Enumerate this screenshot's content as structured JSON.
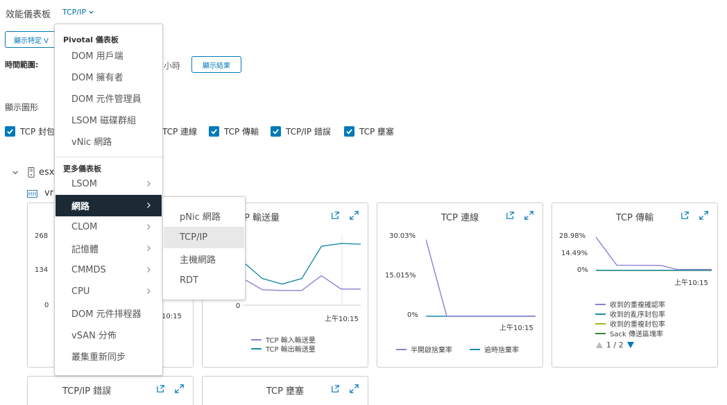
{
  "header": {
    "title": "效能儀表板",
    "dashboard_dropdown": "TCP/IP"
  },
  "filters": {
    "show_specific_label": "顯示特定 V",
    "time_range_label": "時間範圍:",
    "time_range_value": "小時",
    "show_results_label": "顯示結果",
    "show_graph_label": "顯示圖形",
    "graphs": [
      {
        "label": "TCP 封包",
        "checked": true
      },
      {
        "label": "TCP 連線",
        "checked": true
      },
      {
        "label": "TCP 傳輸",
        "checked": true
      },
      {
        "label": "TCP/IP 錯誤",
        "checked": true
      },
      {
        "label": "TCP 壅塞",
        "checked": true
      }
    ]
  },
  "tree": {
    "host_label": "esx",
    "vm_label": "vr"
  },
  "menu": {
    "pivotal_header": "Pivotal 儀表板",
    "pivotal_items": [
      "DOM 用戶端",
      "DOM 擁有者",
      "DOM 元件管理員",
      "LSOM 磁碟群組",
      "vNic 網路"
    ],
    "more_header": "更多儀表板",
    "more_items": [
      {
        "label": "LSOM",
        "submenu": true
      },
      {
        "label": "網路",
        "submenu": true,
        "active": true
      },
      {
        "label": "CLOM",
        "submenu": true
      },
      {
        "label": "記憶體",
        "submenu": true
      },
      {
        "label": "CMMDS",
        "submenu": true
      },
      {
        "label": "CPU",
        "submenu": true
      },
      {
        "label": "DOM 元件排程器",
        "submenu": false
      },
      {
        "label": "vSAN 分佈",
        "submenu": false
      },
      {
        "label": "叢集重新同步",
        "submenu": false
      }
    ]
  },
  "submenu": {
    "items": [
      {
        "label": "pNic 網路"
      },
      {
        "label": "TCP/IP",
        "hover": true
      },
      {
        "label": "主機網路"
      },
      {
        "label": "RDT"
      }
    ]
  },
  "colors": {
    "accent": "#0079b8",
    "menu_active_bg": "#1c2a36",
    "purple": "#8c7fd0",
    "teal": "#1a8ba8",
    "olive": "#a0b81e",
    "green": "#3f7f3f"
  },
  "cards": {
    "packets": {
      "yticks": [
        "268",
        "134",
        "0"
      ],
      "xtick": "10:15"
    },
    "throughput": {
      "title": "TCP 輸送量",
      "title_visible": "P 輸送量",
      "yticks": [
        "0"
      ],
      "xtick": "上午10:15",
      "legend": [
        "TCP 輸入輸送量",
        "TCP 輸出輸送量"
      ]
    },
    "connections": {
      "title": "TCP 連線",
      "yticks": [
        "30.03%",
        "15.015%",
        "0%"
      ],
      "xtick": "上午10:15",
      "legend": [
        "半開啟捨棄率",
        "逾時捨棄率"
      ]
    },
    "transmission": {
      "title": "TCP 傳輸",
      "yticks": [
        "28.98%",
        "14.49%",
        "0%"
      ],
      "xtick": "上午10:15",
      "legend": [
        "收到的重複確認率",
        "收到的亂序封包率",
        "收到的重複封包率",
        "Sack 傳送區塊率"
      ],
      "pager": "1 / 2"
    },
    "errors": {
      "title": "TCP/IP 錯誤"
    },
    "congestion": {
      "title": "TCP 壅塞"
    }
  },
  "chart_data": [
    {
      "type": "line",
      "title": "TCP 輸送量",
      "series": [
        {
          "name": "TCP 輸入輸送量",
          "values": [
            0.38,
            0.22,
            0.21,
            0.21,
            0.42,
            0.23,
            0.23
          ]
        },
        {
          "name": "TCP 輸出輸送量",
          "values": [
            0.62,
            0.38,
            0.3,
            0.38,
            0.84,
            0.88,
            0.87
          ]
        }
      ],
      "ylim": [
        0,
        1
      ]
    },
    {
      "type": "line",
      "title": "TCP 連線",
      "series": [
        {
          "name": "半開啟捨棄率",
          "x": [
            0,
            0.19,
            1
          ],
          "values": [
            28.9,
            0,
            0
          ]
        },
        {
          "name": "逾時捨棄率",
          "x": [
            0,
            1
          ],
          "values": [
            0,
            0
          ]
        }
      ],
      "ylim": [
        0,
        30.03
      ]
    },
    {
      "type": "line",
      "title": "TCP 傳輸",
      "series": [
        {
          "name": "收到的重複確認率",
          "x": [
            0,
            0.18,
            0.56,
            0.7,
            1
          ],
          "values": [
            28.5,
            4.5,
            4.3,
            0.8,
            0.8
          ]
        },
        {
          "name": "收到的亂序封包率",
          "x": [
            0,
            1
          ],
          "values": [
            0.2,
            0.2
          ]
        },
        {
          "name": "收到的重複封包率",
          "x": [
            0,
            1
          ],
          "values": [
            0.1,
            0.1
          ]
        },
        {
          "name": "Sack 傳送區塊率",
          "x": [
            0,
            1
          ],
          "values": [
            0,
            0
          ]
        }
      ],
      "ylim": [
        0,
        28.98
      ]
    }
  ]
}
